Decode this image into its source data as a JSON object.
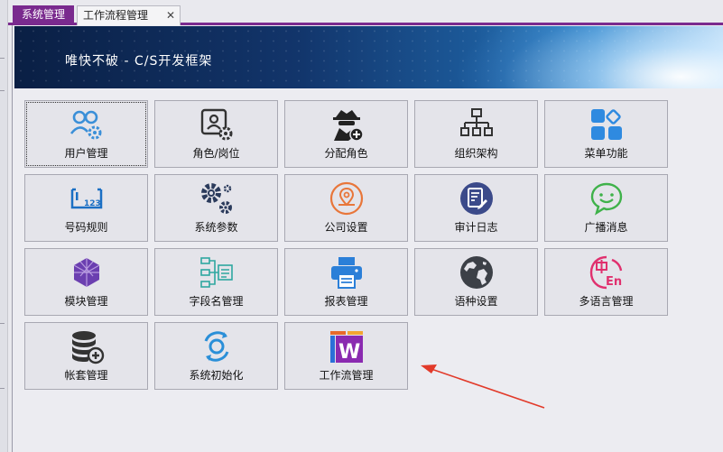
{
  "tabs": [
    {
      "label": "系统管理",
      "active": true
    },
    {
      "label": "工作流程管理",
      "active": false,
      "close": "✕"
    }
  ],
  "banner": {
    "title": "唯快不破 - C/S开发框架"
  },
  "tiles": [
    {
      "label": "用户管理",
      "icon": "users-gear-icon",
      "color": "#3a8fd8"
    },
    {
      "label": "角色/岗位",
      "icon": "id-card-gear-icon",
      "color": "#333333"
    },
    {
      "label": "分配角色",
      "icon": "spy-add-icon",
      "color": "#222222"
    },
    {
      "label": "组织架构",
      "icon": "org-chart-icon",
      "color": "#333333"
    },
    {
      "label": "菜单功能",
      "icon": "menu-blocks-icon",
      "color": "#2f8ae0"
    },
    {
      "label": "号码规则",
      "icon": "number-rule-icon",
      "color": "#1a6fc4"
    },
    {
      "label": "系统参数",
      "icon": "gears-icon",
      "color": "#2b3b5c"
    },
    {
      "label": "公司设置",
      "icon": "location-pin-icon",
      "color": "#e8763a"
    },
    {
      "label": "审计日志",
      "icon": "audit-log-icon",
      "color": "#3b4a8a"
    },
    {
      "label": "广播消息",
      "icon": "chat-smile-icon",
      "color": "#3fb24a"
    },
    {
      "label": "模块管理",
      "icon": "module-cube-icon",
      "color": "#6b3fb0"
    },
    {
      "label": "字段名管理",
      "icon": "field-tree-icon",
      "color": "#2ea7a0"
    },
    {
      "label": "报表管理",
      "icon": "printer-icon",
      "color": "#2b7fd8"
    },
    {
      "label": "语种设置",
      "icon": "globe-icon",
      "color": "#3c4047"
    },
    {
      "label": "多语言管理",
      "icon": "multilang-icon",
      "color": "#e0306e"
    },
    {
      "label": "帐套管理",
      "icon": "database-add-icon",
      "color": "#333333"
    },
    {
      "label": "系统初始化",
      "icon": "refresh-cycle-icon",
      "color": "#2a8fd8"
    },
    {
      "label": "工作流管理",
      "icon": "workflow-w-icon",
      "color": "#8a2ab0"
    }
  ],
  "accent": "#7a2a8e",
  "annotation": {
    "color": "#e23a2a"
  }
}
